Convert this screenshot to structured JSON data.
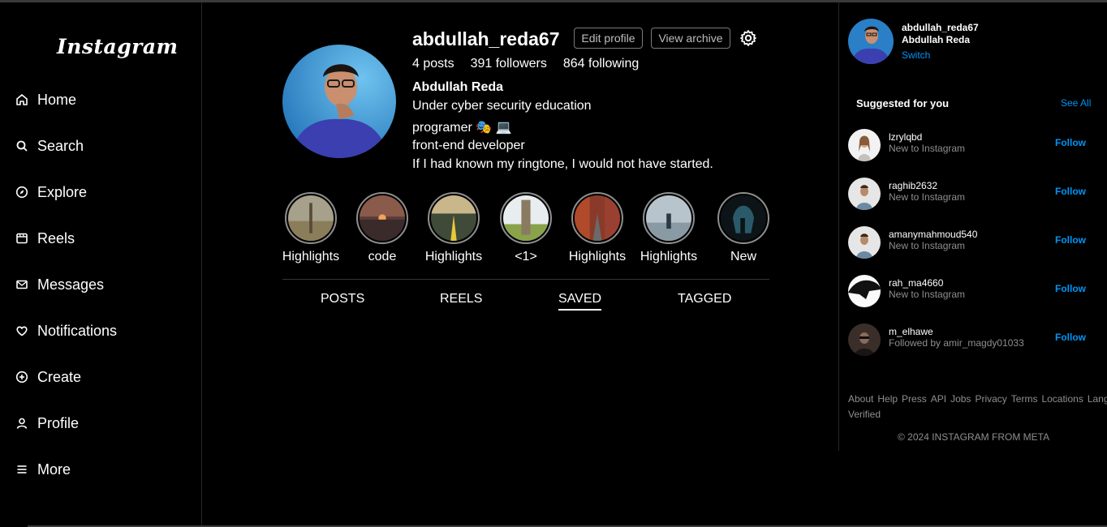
{
  "sidebar": {
    "logo": "Instagram",
    "items": [
      {
        "label": "Home",
        "icon": "home-icon"
      },
      {
        "label": "Search",
        "icon": "search-icon"
      },
      {
        "label": "Explore",
        "icon": "compass-icon"
      },
      {
        "label": "Reels",
        "icon": "reels-icon"
      },
      {
        "label": "Messages",
        "icon": "message-icon"
      },
      {
        "label": "Notifications",
        "icon": "heart-icon"
      },
      {
        "label": "Create",
        "icon": "plus-circle-icon"
      },
      {
        "label": "Profile",
        "icon": "user-icon"
      },
      {
        "label": "More",
        "icon": "menu-icon"
      }
    ]
  },
  "profile": {
    "username": "abdullah_reda67",
    "edit_label": "Edit profile",
    "archive_label": "View archive",
    "posts": "4 posts",
    "followers": "391 followers",
    "following": "864 following",
    "full_name": "Abdullah Reda",
    "bio": [
      "Under cyber security education",
      "programer 🎭 💻",
      "front-end developer",
      "If I had known my ringtone, I would not have started."
    ]
  },
  "highlights": [
    "Highlights",
    "code",
    "Highlights",
    "<1>",
    "Highlights",
    "Highlights",
    "New"
  ],
  "tabs": {
    "posts": "POSTS",
    "reels": "REELS",
    "saved": "SAVED",
    "tagged": "TAGGED",
    "active": "SAVED"
  },
  "me": {
    "username": "abdullah_reda67",
    "name": "Abdullah Reda",
    "switch_label": "Switch"
  },
  "suggestions": {
    "title": "Suggested for you",
    "see_all": "See All",
    "follow_label": "Follow",
    "items": [
      {
        "username": "lzrylqbd",
        "subtitle": "New to Instagram"
      },
      {
        "username": "raghib2632",
        "subtitle": "New to Instagram"
      },
      {
        "username": "amanymahmoud540",
        "subtitle": "New to Instagram"
      },
      {
        "username": "rah_ma4660",
        "subtitle": "New to Instagram"
      },
      {
        "username": "m_elhawe",
        "subtitle": "Followed by amir_magdy01033"
      }
    ]
  },
  "footer": {
    "links": [
      "About",
      "Help",
      "Press",
      "API",
      "Jobs",
      "Privacy",
      "Terms",
      "Locations",
      "Language",
      "Meta Verified"
    ],
    "copyright": "© 2024 INSTAGRAM FROM META"
  },
  "colors": {
    "accent": "#0095f6",
    "background": "#000000",
    "muted": "#8e8e8e"
  }
}
